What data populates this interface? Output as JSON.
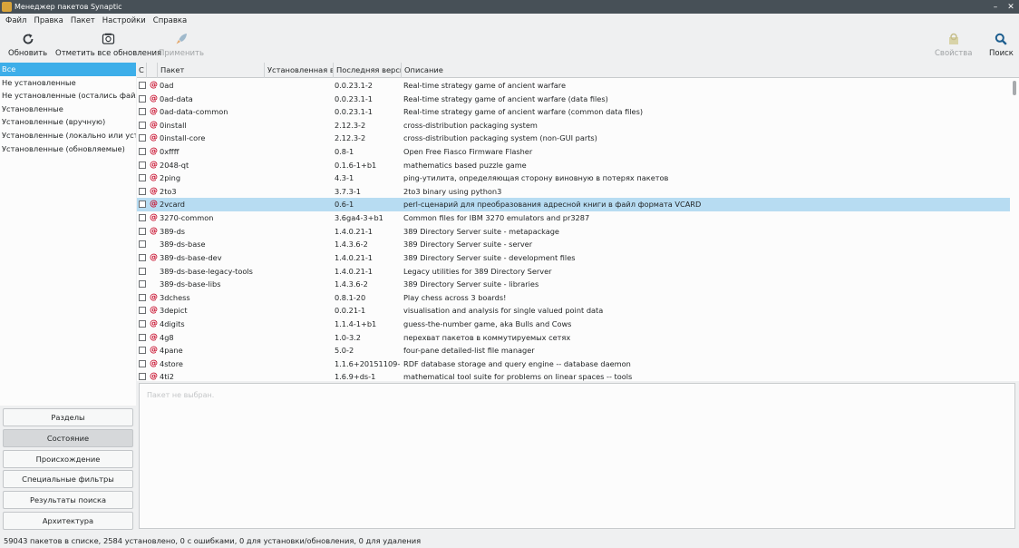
{
  "window": {
    "title": "Менеджер пакетов Synaptic",
    "minimize": "–",
    "close": "✕"
  },
  "menu": [
    "Файл",
    "Правка",
    "Пакет",
    "Настройки",
    "Справка"
  ],
  "toolbar": {
    "reload": {
      "label": "Обновить",
      "icon": "reload-icon"
    },
    "mark_all": {
      "label": "Отметить все обновления",
      "icon": "mark-all-upgrades-icon"
    },
    "apply": {
      "label": "Применить",
      "icon": "apply-rocket-icon",
      "disabled": true
    },
    "properties": {
      "label": "Свойства",
      "icon": "properties-icon",
      "disabled": true
    },
    "search": {
      "label": "Поиск",
      "icon": "search-icon"
    }
  },
  "filters": [
    {
      "label": "Все",
      "selected": true
    },
    {
      "label": "Не установленные"
    },
    {
      "label": "Не установленные (остались файлы настройки)"
    },
    {
      "label": "Установленные"
    },
    {
      "label": "Установленные (вручную)"
    },
    {
      "label": "Установленные (локально или устаревшие)"
    },
    {
      "label": "Установленные (обновляемые)"
    }
  ],
  "side_buttons": [
    {
      "label": "Разделы"
    },
    {
      "label": "Состояние",
      "active": true
    },
    {
      "label": "Происхождение"
    },
    {
      "label": "Специальные фильтры"
    },
    {
      "label": "Результаты поиска"
    },
    {
      "label": "Архитектура"
    }
  ],
  "columns": {
    "status": "С",
    "package": "Пакет",
    "installed": "Установленная версия",
    "latest": "Последняя версия",
    "description": "Описание"
  },
  "packages": [
    {
      "name": "0ad",
      "latest": "0.0.23.1-2",
      "desc": "Real-time strategy game of ancient warfare",
      "debian": true
    },
    {
      "name": "0ad-data",
      "latest": "0.0.23.1-1",
      "desc": "Real-time strategy game of ancient warfare (data files)",
      "debian": true
    },
    {
      "name": "0ad-data-common",
      "latest": "0.0.23.1-1",
      "desc": "Real-time strategy game of ancient warfare (common data files)",
      "debian": true
    },
    {
      "name": "0install",
      "latest": "2.12.3-2",
      "desc": "cross-distribution packaging system",
      "debian": true
    },
    {
      "name": "0install-core",
      "latest": "2.12.3-2",
      "desc": "cross-distribution packaging system (non-GUI parts)",
      "debian": true
    },
    {
      "name": "0xffff",
      "latest": "0.8-1",
      "desc": "Open Free Fiasco Firmware Flasher",
      "debian": true
    },
    {
      "name": "2048-qt",
      "latest": "0.1.6-1+b1",
      "desc": "mathematics based puzzle game",
      "debian": true
    },
    {
      "name": "2ping",
      "latest": "4.3-1",
      "desc": "ping-утилита, определяющая сторону виновную в потерях пакетов",
      "debian": true
    },
    {
      "name": "2to3",
      "latest": "3.7.3-1",
      "desc": "2to3 binary using python3",
      "debian": true
    },
    {
      "name": "2vcard",
      "latest": "0.6-1",
      "desc": "perl-сценарий для преобразования адресной книги в файл формата VCARD",
      "debian": true,
      "selected": true
    },
    {
      "name": "3270-common",
      "latest": "3.6ga4-3+b1",
      "desc": "Common files for IBM 3270 emulators and pr3287",
      "debian": true
    },
    {
      "name": "389-ds",
      "latest": "1.4.0.21-1",
      "desc": "389 Directory Server suite - metapackage",
      "debian": true
    },
    {
      "name": "389-ds-base",
      "latest": "1.4.3.6-2",
      "desc": "389 Directory Server suite - server",
      "debian": false
    },
    {
      "name": "389-ds-base-dev",
      "latest": "1.4.0.21-1",
      "desc": "389 Directory Server suite - development files",
      "debian": true
    },
    {
      "name": "389-ds-base-legacy-tools",
      "latest": "1.4.0.21-1",
      "desc": "Legacy utilities for 389 Directory Server",
      "debian": false
    },
    {
      "name": "389-ds-base-libs",
      "latest": "1.4.3.6-2",
      "desc": "389 Directory Server suite - libraries",
      "debian": false
    },
    {
      "name": "3dchess",
      "latest": "0.8.1-20",
      "desc": "Play chess across 3 boards!",
      "debian": true
    },
    {
      "name": "3depict",
      "latest": "0.0.21-1",
      "desc": "visualisation and analysis for single valued point data",
      "debian": true
    },
    {
      "name": "4digits",
      "latest": "1.1.4-1+b1",
      "desc": "guess-the-number game, aka Bulls and Cows",
      "debian": true
    },
    {
      "name": "4g8",
      "latest": "1.0-3.2",
      "desc": "перехват пакетов в коммутируемых сетях",
      "debian": true
    },
    {
      "name": "4pane",
      "latest": "5.0-2",
      "desc": "four-pane detailed-list file manager",
      "debian": true
    },
    {
      "name": "4store",
      "latest": "1.1.6+20151109-2+b1",
      "desc": "RDF database storage and query engine -- database daemon",
      "debian": true
    },
    {
      "name": "4ti2",
      "latest": "1.6.9+ds-1",
      "desc": "mathematical tool suite for problems on linear spaces -- tools",
      "debian": true
    }
  ],
  "details_placeholder": "Пакет не выбран.",
  "status": "59043 пакетов в списке, 2584 установлено, 0 с ошибками, 0 для установки/обновления, 0 для удаления"
}
